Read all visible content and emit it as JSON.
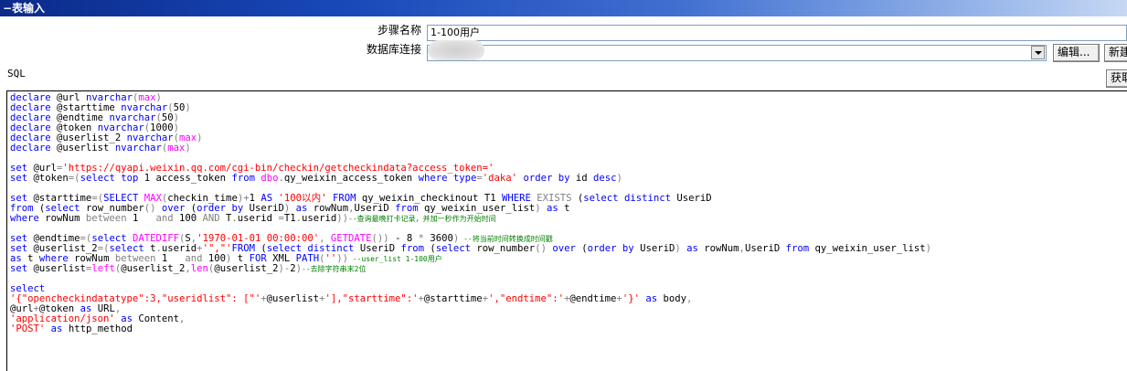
{
  "window": {
    "title": "表输入",
    "collapse_glyph": "−"
  },
  "form": {
    "step_name_label": "步骤名称",
    "step_name_value": "1-100用户",
    "db_conn_label": "数据库连接",
    "db_conn_value": "",
    "edit_button": "编辑...",
    "new_button": "新建",
    "fetch_button": "获取"
  },
  "sql_label": "SQL",
  "colors": {
    "keyword": "#0000ff",
    "function": "#ff00ff",
    "string": "#ff0000",
    "operator": "#808080",
    "comment": "#008000"
  },
  "code": [
    [
      {
        "t": "declare",
        "c": "kw"
      },
      {
        "t": " @url "
      },
      {
        "t": "nvarchar",
        "c": "kw"
      },
      {
        "t": "(",
        "c": "gr"
      },
      {
        "t": "max",
        "c": "fn"
      },
      {
        "t": ")",
        "c": "gr"
      }
    ],
    [
      {
        "t": "declare",
        "c": "kw"
      },
      {
        "t": " @starttime "
      },
      {
        "t": "nvarchar",
        "c": "kw"
      },
      {
        "t": "(",
        "c": "gr"
      },
      {
        "t": "50"
      },
      {
        "t": ")",
        "c": "gr"
      }
    ],
    [
      {
        "t": "declare",
        "c": "kw"
      },
      {
        "t": " @endtime "
      },
      {
        "t": "nvarchar",
        "c": "kw"
      },
      {
        "t": "(",
        "c": "gr"
      },
      {
        "t": "50"
      },
      {
        "t": ")",
        "c": "gr"
      }
    ],
    [
      {
        "t": "declare",
        "c": "kw"
      },
      {
        "t": " @token "
      },
      {
        "t": "nvarchar",
        "c": "kw"
      },
      {
        "t": "(",
        "c": "gr"
      },
      {
        "t": "1000"
      },
      {
        "t": ")",
        "c": "gr"
      }
    ],
    [
      {
        "t": "declare",
        "c": "kw"
      },
      {
        "t": " @userlist_2 "
      },
      {
        "t": "nvarchar",
        "c": "kw"
      },
      {
        "t": "(",
        "c": "gr"
      },
      {
        "t": "max",
        "c": "fn"
      },
      {
        "t": ")",
        "c": "gr"
      }
    ],
    [
      {
        "t": "declare",
        "c": "kw"
      },
      {
        "t": " @userlist "
      },
      {
        "t": "nvarchar",
        "c": "kw"
      },
      {
        "t": "(",
        "c": "gr"
      },
      {
        "t": "max",
        "c": "fn"
      },
      {
        "t": ")",
        "c": "gr"
      }
    ],
    [],
    [
      {
        "t": "set",
        "c": "kw"
      },
      {
        "t": " @url"
      },
      {
        "t": "=",
        "c": "gr"
      },
      {
        "t": "'https://qyapi.weixin.qq.com/cgi-bin/checkin/getcheckindata?access_token='",
        "c": "str"
      }
    ],
    [
      {
        "t": "set",
        "c": "kw"
      },
      {
        "t": " @token"
      },
      {
        "t": "=(",
        "c": "gr"
      },
      {
        "t": "select",
        "c": "kw"
      },
      {
        "t": " "
      },
      {
        "t": "top",
        "c": "kw"
      },
      {
        "t": " 1 access_token "
      },
      {
        "t": "from",
        "c": "kw"
      },
      {
        "t": " "
      },
      {
        "t": "dbo",
        "c": "fn"
      },
      {
        "t": ".",
        "c": "gr"
      },
      {
        "t": "qy_weixin_access_token "
      },
      {
        "t": "where",
        "c": "kw"
      },
      {
        "t": " "
      },
      {
        "t": "type",
        "c": "kw"
      },
      {
        "t": "=",
        "c": "gr"
      },
      {
        "t": "'daka'",
        "c": "str"
      },
      {
        "t": " "
      },
      {
        "t": "order",
        "c": "kw"
      },
      {
        "t": " "
      },
      {
        "t": "by",
        "c": "kw"
      },
      {
        "t": " id "
      },
      {
        "t": "desc",
        "c": "kw"
      },
      {
        "t": ")",
        "c": "gr"
      }
    ],
    [],
    [
      {
        "t": "set",
        "c": "kw"
      },
      {
        "t": " @starttime"
      },
      {
        "t": "=(",
        "c": "gr"
      },
      {
        "t": "SELECT",
        "c": "kw"
      },
      {
        "t": " "
      },
      {
        "t": "MAX",
        "c": "fn"
      },
      {
        "t": "(",
        "c": "gr"
      },
      {
        "t": "checkin_time"
      },
      {
        "t": ")+",
        "c": "gr"
      },
      {
        "t": "1 "
      },
      {
        "t": "AS",
        "c": "kw"
      },
      {
        "t": " "
      },
      {
        "t": "'100以内'",
        "c": "str"
      },
      {
        "t": " "
      },
      {
        "t": "FROM",
        "c": "kw"
      },
      {
        "t": " qy_weixin_checkinout T1 "
      },
      {
        "t": "WHERE",
        "c": "kw"
      },
      {
        "t": " "
      },
      {
        "t": "EXISTS",
        "c": "gr"
      },
      {
        "t": " ("
      },
      {
        "t": "select",
        "c": "kw"
      },
      {
        "t": " "
      },
      {
        "t": "distinct",
        "c": "kw"
      },
      {
        "t": " UseriD"
      }
    ],
    [
      {
        "t": "from",
        "c": "kw"
      },
      {
        "t": " ("
      },
      {
        "t": "select",
        "c": "kw"
      },
      {
        "t": " row_number"
      },
      {
        "t": "()",
        "c": "gr"
      },
      {
        "t": " "
      },
      {
        "t": "over",
        "c": "kw"
      },
      {
        "t": " ("
      },
      {
        "t": "order",
        "c": "kw"
      },
      {
        "t": " "
      },
      {
        "t": "by",
        "c": "kw"
      },
      {
        "t": " UseriD"
      },
      {
        "t": ")",
        "c": "gr"
      },
      {
        "t": " "
      },
      {
        "t": "as",
        "c": "kw"
      },
      {
        "t": " rowNum"
      },
      {
        "t": ",",
        "c": "gr"
      },
      {
        "t": "UseriD "
      },
      {
        "t": "from",
        "c": "kw"
      },
      {
        "t": " qy_weixin_user_list"
      },
      {
        "t": ")",
        "c": "gr"
      },
      {
        "t": " "
      },
      {
        "t": "as",
        "c": "kw"
      },
      {
        "t": " t"
      }
    ],
    [
      {
        "t": "where",
        "c": "kw"
      },
      {
        "t": " rowNum "
      },
      {
        "t": "between",
        "c": "gr"
      },
      {
        "t": " 1   "
      },
      {
        "t": "and",
        "c": "gr"
      },
      {
        "t": " 100 "
      },
      {
        "t": "AND",
        "c": "gr"
      },
      {
        "t": " T"
      },
      {
        "t": ".",
        "c": "gr"
      },
      {
        "t": "userid "
      },
      {
        "t": "=",
        "c": "gr"
      },
      {
        "t": "T1"
      },
      {
        "t": ".",
        "c": "gr"
      },
      {
        "t": "userid"
      },
      {
        "t": "))",
        "c": "gr"
      },
      {
        "t": "--查询最晚打卡记录，并加一秒作为开始时间",
        "c": "cm"
      }
    ],
    [],
    [
      {
        "t": "set",
        "c": "kw"
      },
      {
        "t": " @endtime"
      },
      {
        "t": "=(",
        "c": "gr"
      },
      {
        "t": "select",
        "c": "kw"
      },
      {
        "t": " "
      },
      {
        "t": "DATEDIFF",
        "c": "fn"
      },
      {
        "t": "(",
        "c": "gr"
      },
      {
        "t": "S"
      },
      {
        "t": ",",
        "c": "gr"
      },
      {
        "t": "'1970-01-01 00:00:00'",
        "c": "str"
      },
      {
        "t": ", ",
        "c": "gr"
      },
      {
        "t": "GETDATE",
        "c": "fn"
      },
      {
        "t": "())",
        "c": "gr"
      },
      {
        "t": " - 8 "
      },
      {
        "t": "*",
        "c": "gr"
      },
      {
        "t": " 3600"
      },
      {
        "t": ")",
        "c": "gr"
      },
      {
        "t": " --将当前时间转换成时间戳",
        "c": "cm"
      }
    ],
    [
      {
        "t": "set",
        "c": "kw"
      },
      {
        "t": " @userlist_2"
      },
      {
        "t": "=(",
        "c": "gr"
      },
      {
        "t": "select",
        "c": "kw"
      },
      {
        "t": " t"
      },
      {
        "t": ".",
        "c": "gr"
      },
      {
        "t": "userid"
      },
      {
        "t": "+",
        "c": "gr"
      },
      {
        "t": "'\",\"'",
        "c": "str"
      },
      {
        "t": "FROM",
        "c": "kw"
      },
      {
        "t": " ("
      },
      {
        "t": "select",
        "c": "kw"
      },
      {
        "t": " "
      },
      {
        "t": "distinct",
        "c": "kw"
      },
      {
        "t": " UseriD "
      },
      {
        "t": "from",
        "c": "kw"
      },
      {
        "t": " ("
      },
      {
        "t": "select",
        "c": "kw"
      },
      {
        "t": " row_number"
      },
      {
        "t": "()",
        "c": "gr"
      },
      {
        "t": " "
      },
      {
        "t": "over",
        "c": "kw"
      },
      {
        "t": " ("
      },
      {
        "t": "order",
        "c": "kw"
      },
      {
        "t": " "
      },
      {
        "t": "by",
        "c": "kw"
      },
      {
        "t": " UseriD"
      },
      {
        "t": ")",
        "c": "gr"
      },
      {
        "t": " "
      },
      {
        "t": "as",
        "c": "kw"
      },
      {
        "t": " rowNum"
      },
      {
        "t": ",",
        "c": "gr"
      },
      {
        "t": "UseriD "
      },
      {
        "t": "from",
        "c": "kw"
      },
      {
        "t": " qy_weixin_user_list"
      },
      {
        "t": ")",
        "c": "gr"
      }
    ],
    [
      {
        "t": "as",
        "c": "kw"
      },
      {
        "t": " t "
      },
      {
        "t": "where",
        "c": "kw"
      },
      {
        "t": " rowNum "
      },
      {
        "t": "between",
        "c": "gr"
      },
      {
        "t": " 1   "
      },
      {
        "t": "and",
        "c": "gr"
      },
      {
        "t": " 100"
      },
      {
        "t": ")",
        "c": "gr"
      },
      {
        "t": " t "
      },
      {
        "t": "FOR",
        "c": "kw"
      },
      {
        "t": " XML "
      },
      {
        "t": "PATH",
        "c": "kw"
      },
      {
        "t": "(",
        "c": "gr"
      },
      {
        "t": "''",
        "c": "str"
      },
      {
        "t": "))",
        "c": "gr"
      },
      {
        "t": " --user_list 1-100用户",
        "c": "cm"
      }
    ],
    [
      {
        "t": "set",
        "c": "kw"
      },
      {
        "t": " @userlist"
      },
      {
        "t": "=",
        "c": "gr"
      },
      {
        "t": "left",
        "c": "fn"
      },
      {
        "t": "(",
        "c": "gr"
      },
      {
        "t": "@userlist_2"
      },
      {
        "t": ",",
        "c": "gr"
      },
      {
        "t": "len",
        "c": "fn"
      },
      {
        "t": "(",
        "c": "gr"
      },
      {
        "t": "@userlist_2"
      },
      {
        "t": ")-",
        "c": "gr"
      },
      {
        "t": "2"
      },
      {
        "t": ")",
        "c": "gr"
      },
      {
        "t": "--去除字符串末2位",
        "c": "cm"
      }
    ],
    [],
    [
      {
        "t": "select",
        "c": "kw"
      }
    ],
    [
      {
        "t": "'{\"opencheckindatatype\":3,\"useridlist\": [\"'",
        "c": "str"
      },
      {
        "t": "+",
        "c": "gr"
      },
      {
        "t": "@userlist"
      },
      {
        "t": "+",
        "c": "gr"
      },
      {
        "t": "'],\"starttime\":'",
        "c": "str"
      },
      {
        "t": "+",
        "c": "gr"
      },
      {
        "t": "@starttime"
      },
      {
        "t": "+",
        "c": "gr"
      },
      {
        "t": "',\"endtime\":'",
        "c": "str"
      },
      {
        "t": "+",
        "c": "gr"
      },
      {
        "t": "@endtime"
      },
      {
        "t": "+",
        "c": "gr"
      },
      {
        "t": "'}'",
        "c": "str"
      },
      {
        "t": " "
      },
      {
        "t": "as",
        "c": "kw"
      },
      {
        "t": " body"
      },
      {
        "t": ",",
        "c": "gr"
      }
    ],
    [
      {
        "t": "@url"
      },
      {
        "t": "+",
        "c": "gr"
      },
      {
        "t": "@token "
      },
      {
        "t": "as",
        "c": "kw"
      },
      {
        "t": " URL"
      },
      {
        "t": ",",
        "c": "gr"
      }
    ],
    [
      {
        "t": "'application/json'",
        "c": "str"
      },
      {
        "t": " "
      },
      {
        "t": "as",
        "c": "kw"
      },
      {
        "t": " Content"
      },
      {
        "t": ",",
        "c": "gr"
      }
    ],
    [
      {
        "t": "'POST'",
        "c": "str"
      },
      {
        "t": " "
      },
      {
        "t": "as",
        "c": "kw"
      },
      {
        "t": " http_method"
      }
    ]
  ]
}
